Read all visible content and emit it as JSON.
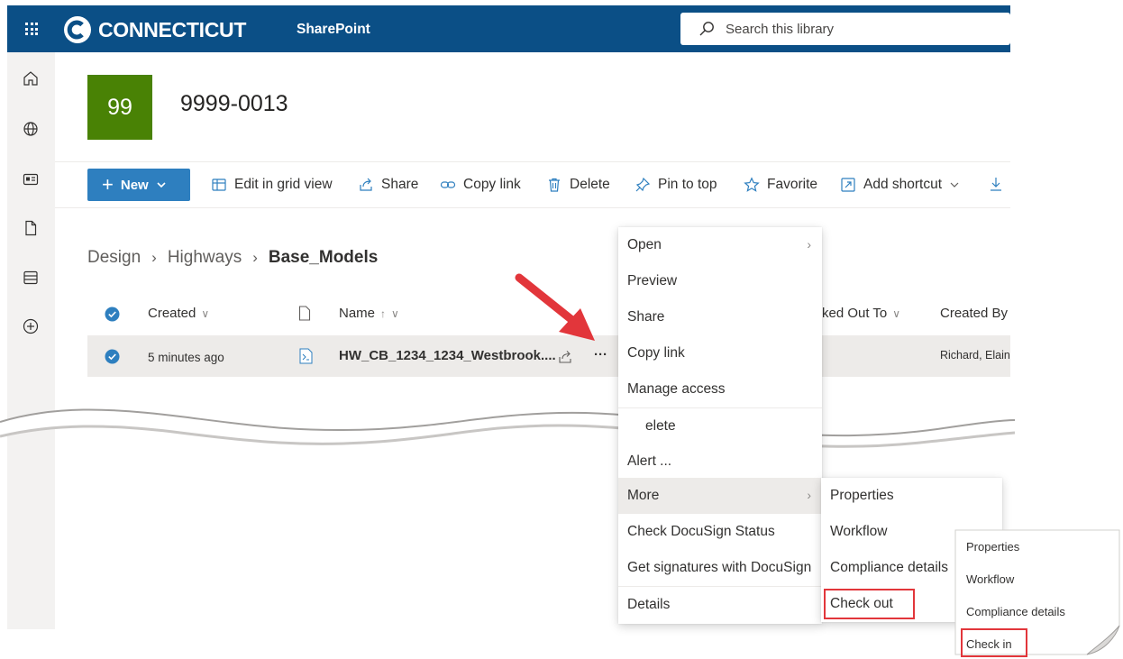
{
  "suitebar": {
    "brand": "CONNECTICUT",
    "app_name": "SharePoint",
    "search_placeholder": "Search this library",
    "brand_color": "#0b4f86"
  },
  "rail": {
    "icons": [
      "home-icon",
      "globe-icon",
      "news-icon",
      "document-icon",
      "list-icon",
      "add-circle-icon"
    ]
  },
  "site": {
    "logo_text": "99",
    "logo_color": "#498205",
    "title": "9999-0013"
  },
  "command_bar": {
    "new_label": "New",
    "items": [
      {
        "label": "Edit in grid view",
        "icon": "grid-icon"
      },
      {
        "label": "Share",
        "icon": "share-icon"
      },
      {
        "label": "Copy link",
        "icon": "link-icon"
      },
      {
        "label": "Delete",
        "icon": "trash-icon"
      },
      {
        "label": "Pin to top",
        "icon": "pin-icon"
      },
      {
        "label": "Favorite",
        "icon": "star-icon"
      },
      {
        "label": "Add shortcut",
        "icon": "shortcut-icon"
      }
    ]
  },
  "breadcrumb": [
    "Design",
    "Highways",
    "Base_Models"
  ],
  "list": {
    "columns": {
      "created": "Created",
      "name": "Name",
      "checked_out_to": "ked Out To",
      "created_by": "Created By"
    },
    "row": {
      "created": "5 minutes ago",
      "name": "HW_CB_1234_1234_Westbrook....",
      "created_by": "Richard, Elain",
      "more": "···"
    }
  },
  "context_menu": {
    "items": [
      "Open",
      "Preview",
      "Share",
      "Copy link",
      "Manage access",
      "elete",
      "Alert ...",
      "More",
      "Check DocuSign Status",
      "Get signatures with DocuSign",
      "Details"
    ]
  },
  "more_submenu": {
    "items": [
      "Properties",
      "Workflow",
      "Compliance details",
      "Check out"
    ]
  },
  "checked_out_submenu": {
    "items": [
      "Properties",
      "Workflow",
      "Compliance details",
      "Check in"
    ]
  },
  "accent_colors": {
    "highlight": "#e2363b",
    "selected_check": "#2e7fbf"
  }
}
